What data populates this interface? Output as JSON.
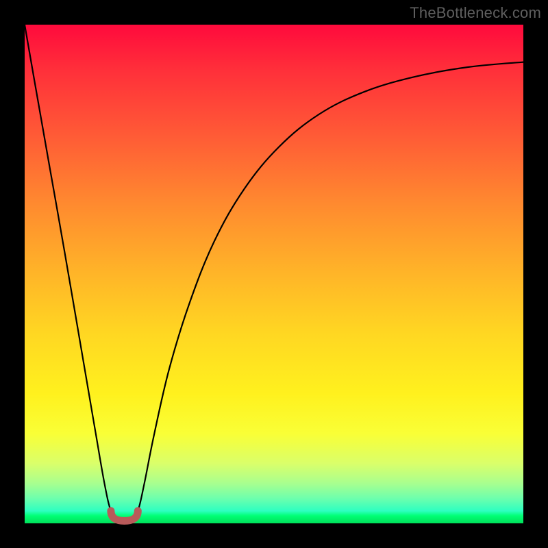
{
  "watermark": "TheBottleneck.com",
  "colors": {
    "frame": "#000000",
    "curve": "#000000",
    "marker": "#b85a5a",
    "watermark": "#5f5f5f"
  },
  "chart_data": {
    "type": "line",
    "title": "",
    "xlabel": "",
    "ylabel": "",
    "xlim": [
      0,
      100
    ],
    "ylim": [
      0,
      100
    ],
    "grid": false,
    "legend": false,
    "series": [
      {
        "name": "bottleneck-curve",
        "x": [
          0,
          2,
          5,
          8,
          11,
          14,
          16,
          17.3,
          18.6,
          20,
          21.4,
          22.7,
          24,
          26,
          29,
          33,
          38,
          44,
          51,
          59,
          68,
          78,
          89,
          100
        ],
        "y": [
          100,
          88.5,
          71.5,
          54.5,
          37,
          19.5,
          8,
          2.5,
          0.8,
          0.5,
          0.8,
          2.5,
          8,
          18,
          31,
          44,
          56.5,
          67,
          75.5,
          82,
          86.5,
          89.5,
          91.5,
          92.5
        ]
      }
    ],
    "minimum_marker": {
      "x_range": [
        17.3,
        22.7
      ],
      "y_range": [
        0.5,
        2.5
      ]
    },
    "gradient_stops": [
      {
        "pos": 0.0,
        "color": "#ff0a3c"
      },
      {
        "pos": 0.5,
        "color": "#ffb528"
      },
      {
        "pos": 0.82,
        "color": "#f9ff36"
      },
      {
        "pos": 1.0,
        "color": "#00e05a"
      }
    ]
  }
}
